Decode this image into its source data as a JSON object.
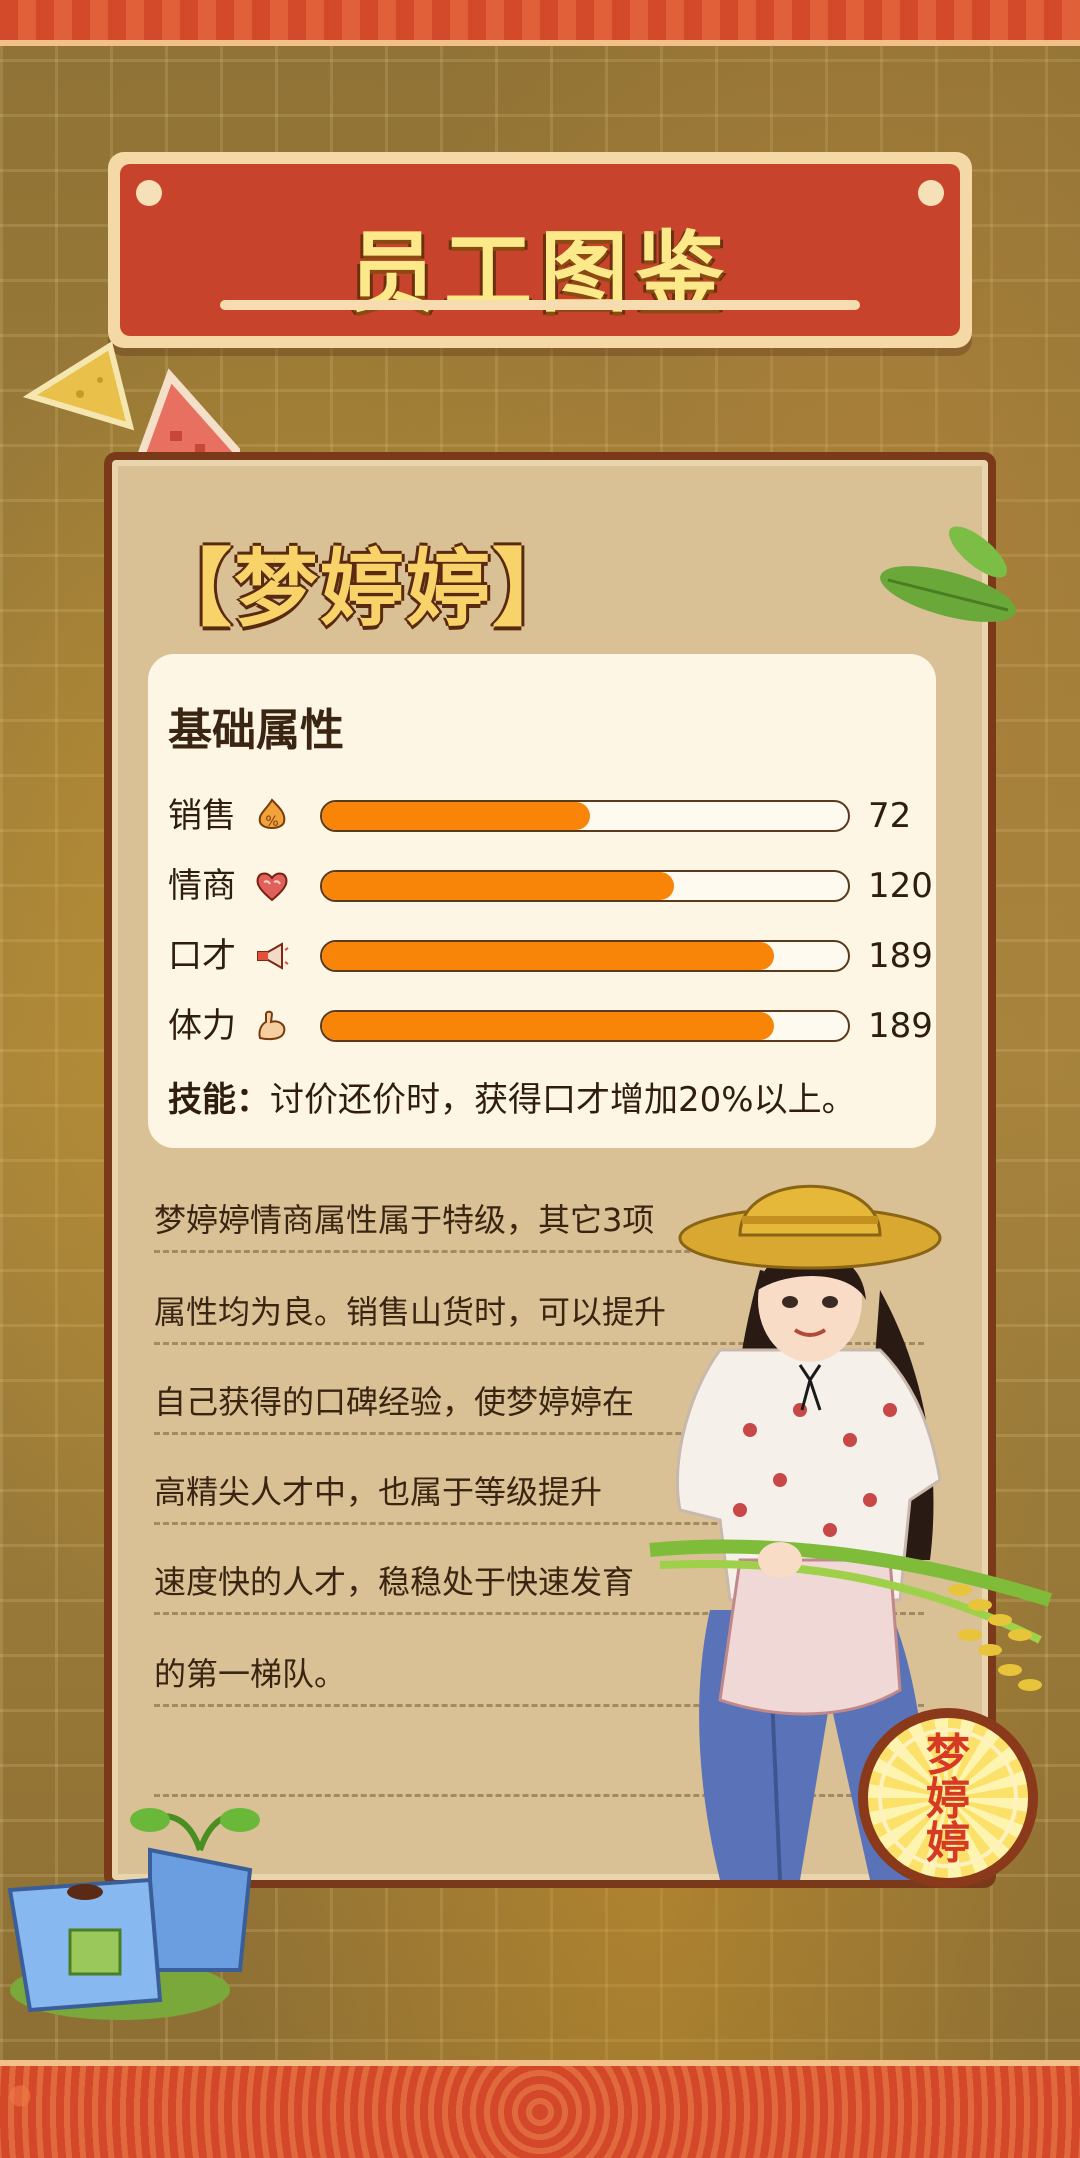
{
  "page": {
    "title": "员工图鉴",
    "character_name": "【梦婷婷】",
    "badge_name": [
      "梦",
      "婷",
      "婷"
    ]
  },
  "stats": {
    "heading": "基础属性",
    "items": [
      {
        "label": "销售",
        "icon": "sales-flame-icon",
        "value": "72",
        "fill": 0.51
      },
      {
        "label": "情商",
        "icon": "heart-brain-icon",
        "value": "120",
        "fill": 0.67
      },
      {
        "label": "口才",
        "icon": "megaphone-icon",
        "value": "189",
        "fill": 0.86
      },
      {
        "label": "体力",
        "icon": "flexed-arm-icon",
        "value": "189",
        "fill": 0.86
      }
    ],
    "skill_label": "技能：",
    "skill_text": "讨价还价时，获得口才增加20%以上。"
  },
  "description": [
    "梦婷婷情商属性属于特级，其它3项",
    "属性均为良。销售山货时，可以提升",
    "自己获得的口碑经验，使梦婷婷在",
    "高精尖人才中，也属于等级提升",
    "速度快的人才，稳稳处于快速发育",
    "的第一梯队。"
  ],
  "colors": {
    "banner_red": "#c8432b",
    "bar_orange": "#f88408",
    "card_bg": "#d9c195",
    "title_yellow": "#fbe98a"
  }
}
